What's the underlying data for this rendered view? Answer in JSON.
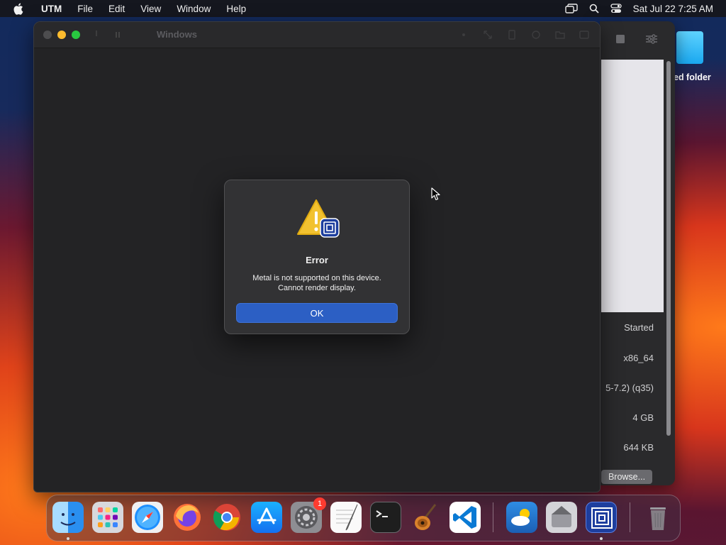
{
  "menubar": {
    "app": "UTM",
    "items": [
      "File",
      "Edit",
      "View",
      "Window",
      "Help"
    ],
    "datetime": "Sat Jul 22  7:25 AM"
  },
  "desktop": {
    "folder_label": "ed folder"
  },
  "utm_panel": {
    "status": "Started",
    "architecture": "x86_64",
    "machine": "5-7.2) (q35)",
    "memory": "4 GB",
    "size": "644 KB",
    "browse_label": "Browse..."
  },
  "vm_window": {
    "title": "Windows"
  },
  "dialog": {
    "title": "Error",
    "message_line1": "Metal is not supported on this device.",
    "message_line2": "Cannot render display.",
    "ok_label": "OK"
  },
  "dock": {
    "apps": [
      "finder-icon",
      "launchpad-icon",
      "safari-icon",
      "firefox-icon",
      "chrome-icon",
      "app-store-icon",
      "system-settings-icon",
      "textedit-icon",
      "terminal-icon",
      "garageband-icon",
      "vscode-icon",
      "weather-icon",
      "migration-icon",
      "utm-icon",
      "trash-icon"
    ],
    "settings_badge": "1"
  }
}
